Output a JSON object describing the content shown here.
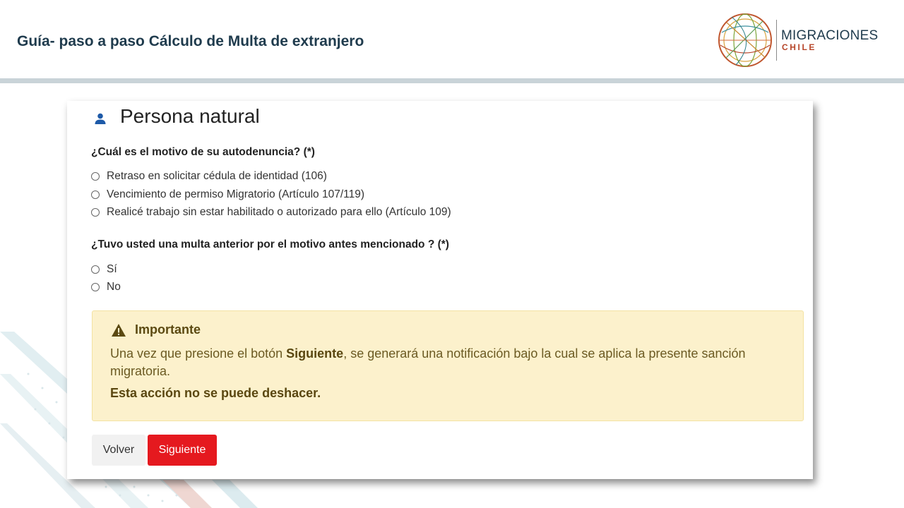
{
  "slide": {
    "title": "Guía- paso a paso Cálculo de Multa de extranjero"
  },
  "logo": {
    "main": "MIGRACIONES",
    "sub": "CHILE"
  },
  "form": {
    "title": "Persona natural",
    "question1": "¿Cuál es el motivo de su autodenuncia? (*)",
    "options1": [
      "Retraso en solicitar cédula de identidad (106)",
      "Vencimiento de permiso Migratorio (Artículo 107/119)",
      "Realicé trabajo sin estar habilitado o autorizado para ello (Artículo 109)"
    ],
    "question2": "¿Tuvo usted una multa anterior por el motivo antes mencionado ? (*)",
    "options2": [
      "Sí",
      "No"
    ]
  },
  "alert": {
    "title": "Importante",
    "body_pre": "Una vez que presione el botón ",
    "body_bold": "Siguiente",
    "body_post": ", se generará una notificación bajo la cual se aplica la presente sanción migratoria.",
    "warning": "Esta acción no se puede deshacer."
  },
  "buttons": {
    "back": "Volver",
    "next": "Siguiente"
  },
  "colors": {
    "title_text": "#1f3b4d",
    "next_button": "#e5191f",
    "alert_bg": "#fcf1cc",
    "icon_blue": "#1e5aa8"
  },
  "icons": {
    "form_header": "person-icon",
    "alert": "warning-icon"
  }
}
